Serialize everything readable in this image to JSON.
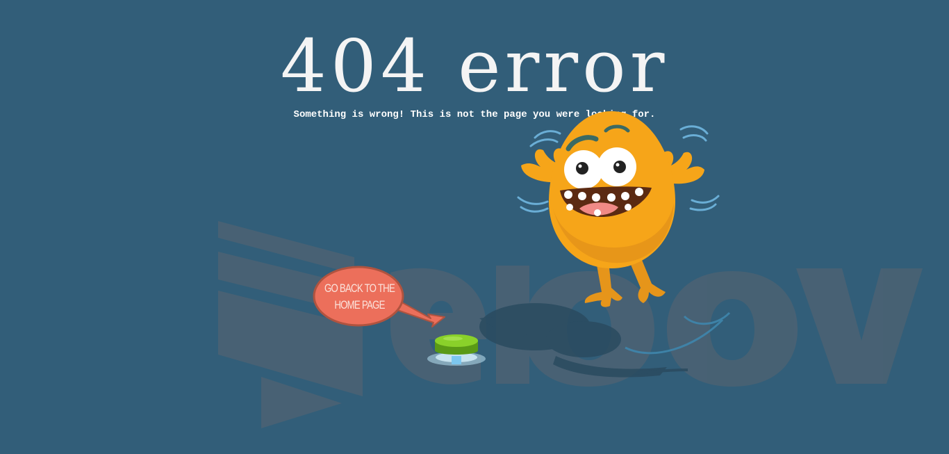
{
  "page": {
    "title": "404 error",
    "subtitle": "Something is wrong! This is not the page you were looking for."
  },
  "bubble": {
    "line1": "GO BACK TO THE",
    "line2": "HOME PAGE"
  },
  "colors": {
    "background": "#325e79",
    "bubble": "#ec6f5b",
    "monster": "#f6a519",
    "button": "#7ac522",
    "watermark": "#56606a"
  },
  "icons": {
    "home_button": "green-push-button-icon",
    "monster": "orange-monster-illustration",
    "watermark": "watermark-logo"
  }
}
